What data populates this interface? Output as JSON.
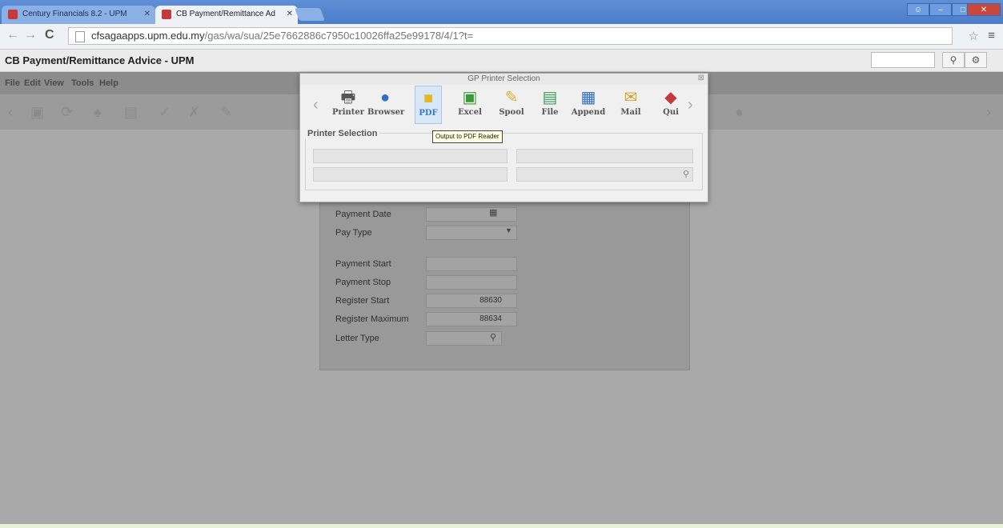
{
  "browser": {
    "tabs": [
      {
        "title": "Century Financials 8.2 - UPM"
      },
      {
        "title": "CB Payment/Remittance Ad"
      }
    ],
    "url_host": "cfsagaapps.upm.edu.my",
    "url_path": "/gas/wa/sua/25e7662886c7950c10026ffa25e99178/4/1?t="
  },
  "app": {
    "title": "CB Payment/Remittance Advice - UPM",
    "menu": [
      "File",
      "Edit",
      "View",
      "Tools",
      "Help"
    ]
  },
  "dialog": {
    "title": "GP Printer Selection",
    "buttons": [
      {
        "label": "Printer",
        "icon": "printer-icon"
      },
      {
        "label": "Browser",
        "icon": "browser-icon"
      },
      {
        "label": "PDF",
        "icon": "pdf-folder-icon"
      },
      {
        "label": "Excel",
        "icon": "excel-icon"
      },
      {
        "label": "Spool",
        "icon": "spool-icon"
      },
      {
        "label": "File",
        "icon": "file-icon"
      },
      {
        "label": "Append",
        "icon": "append-icon"
      },
      {
        "label": "Mail",
        "icon": "mail-icon"
      },
      {
        "label": "Qui",
        "icon": "quit-icon"
      }
    ],
    "tooltip": "Output to PDF Reader",
    "section_title": "Printer Selection"
  },
  "form": {
    "fields": [
      {
        "label": "Payment Date",
        "value": ""
      },
      {
        "label": "Pay Type",
        "value": ""
      },
      {
        "label": "Payment Start",
        "value": ""
      },
      {
        "label": "Payment Stop",
        "value": ""
      },
      {
        "label": "Register Start",
        "value": "88630"
      },
      {
        "label": "Register Maximum",
        "value": "88634"
      },
      {
        "label": "Letter Type",
        "value": ""
      }
    ]
  },
  "colors": {
    "title_bar": "#4a7cc8",
    "dim_background": "#a9a9a9",
    "dialog_background": "#f0f0f0",
    "hot_button": "#d7e7f6"
  }
}
